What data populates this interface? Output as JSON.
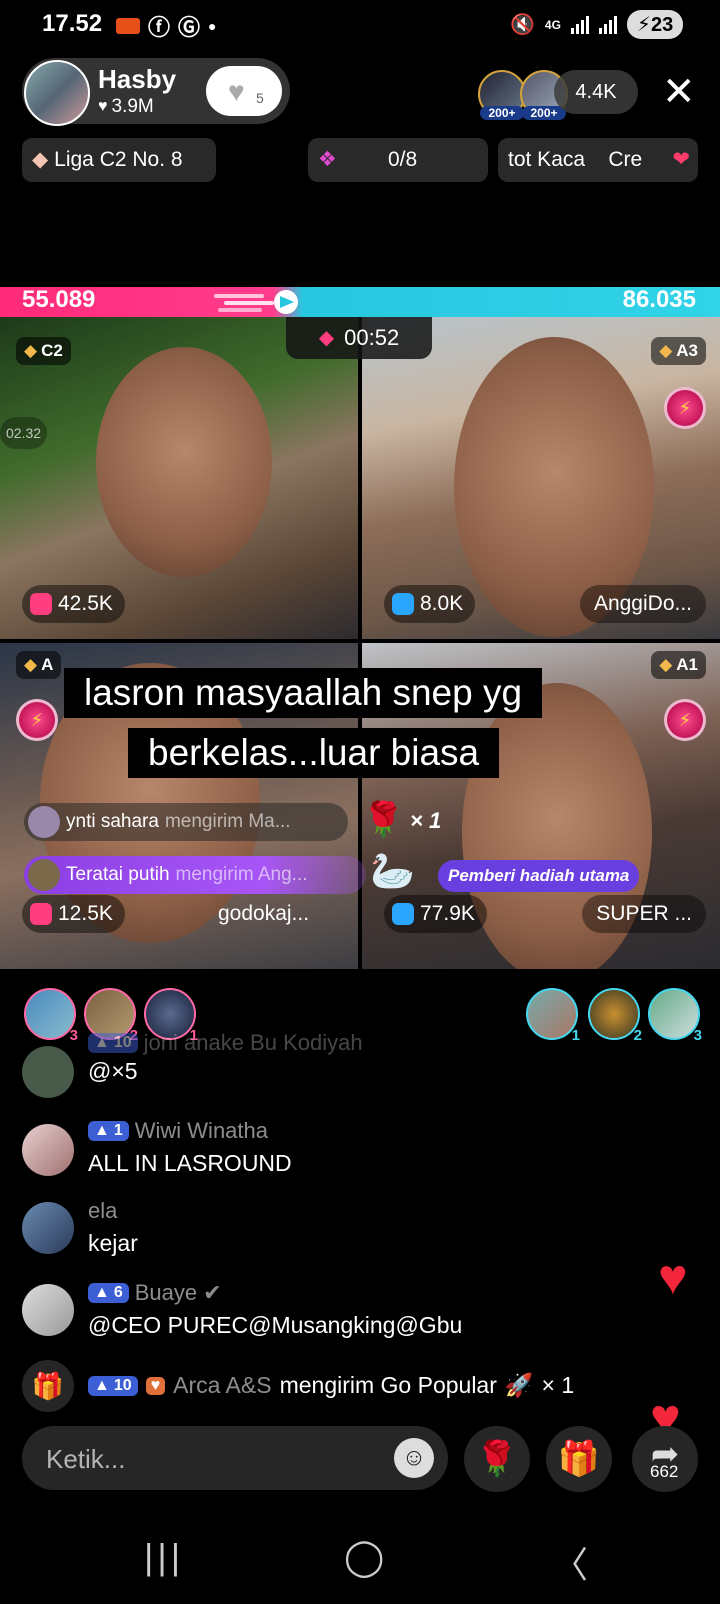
{
  "status": {
    "time": "17.52",
    "battery": "23",
    "network": "4G",
    "icons_left": [
      "record-icon",
      "facebook-icon",
      "google-icon",
      "dot-icon"
    ],
    "icons_right": [
      "mute-icon",
      "network-icon",
      "signal-icon",
      "signal-icon",
      "battery-icon"
    ]
  },
  "host": {
    "name": "Hasby",
    "likes": "3.9M",
    "follow_count": "5"
  },
  "viewers": {
    "badges": [
      "200+",
      "200+"
    ],
    "count": "4.4K"
  },
  "chips": {
    "league": "Liga C2 No. 8",
    "goal": "0/8",
    "scroll_text": "tot Kaca    Cre"
  },
  "battle": {
    "score_left": "55.089",
    "score_right": "86.035",
    "timer": "00:52",
    "colors": {
      "left": "#ff2a7a",
      "right": "#30d3e8"
    }
  },
  "tiles": [
    {
      "rank": "C2",
      "stat": "42.5K",
      "name": "",
      "side_time": "02.32"
    },
    {
      "rank": "A3",
      "stat": "8.0K",
      "name": "AnggiDo..."
    },
    {
      "rank": "A",
      "stat": "12.5K",
      "name": "godokaj..."
    },
    {
      "rank": "A1",
      "stat": "77.9K",
      "name": "SUPER ..."
    }
  ],
  "caption": {
    "line1": "lasron masyaallah snep yg",
    "line2": "berkelas...luar biasa"
  },
  "notifications": {
    "n1_user": "ynti sahara",
    "n1_text": "mengirim Ma...",
    "n2_user": "Teratai putih",
    "n2_text": "mengirim Ang...",
    "rose_count": "× 1",
    "top_gifter": "Pemberi hadiah utama"
  },
  "ranking": {
    "left": [
      "3",
      "2",
      "1"
    ],
    "right": [
      "1",
      "2",
      "3"
    ]
  },
  "chat": [
    {
      "meta_level": "10",
      "user": "joni anake Bu Kodiyah",
      "text": "@×5"
    },
    {
      "meta_level": "1",
      "user": "Wiwi Winatha",
      "text": "ALL IN LASROUND"
    },
    {
      "meta_level": "",
      "user": "ela",
      "text": "kejar"
    },
    {
      "meta_level": "6",
      "user": "Buaye",
      "text": "@CEO PUREC@Musangking@Gbu"
    }
  ],
  "gift_line": {
    "level": "10",
    "user": "Arca A&S",
    "action": "mengirim Go Popular",
    "count": "× 1"
  },
  "input": {
    "placeholder": "Ketik...",
    "share_count": "662"
  }
}
